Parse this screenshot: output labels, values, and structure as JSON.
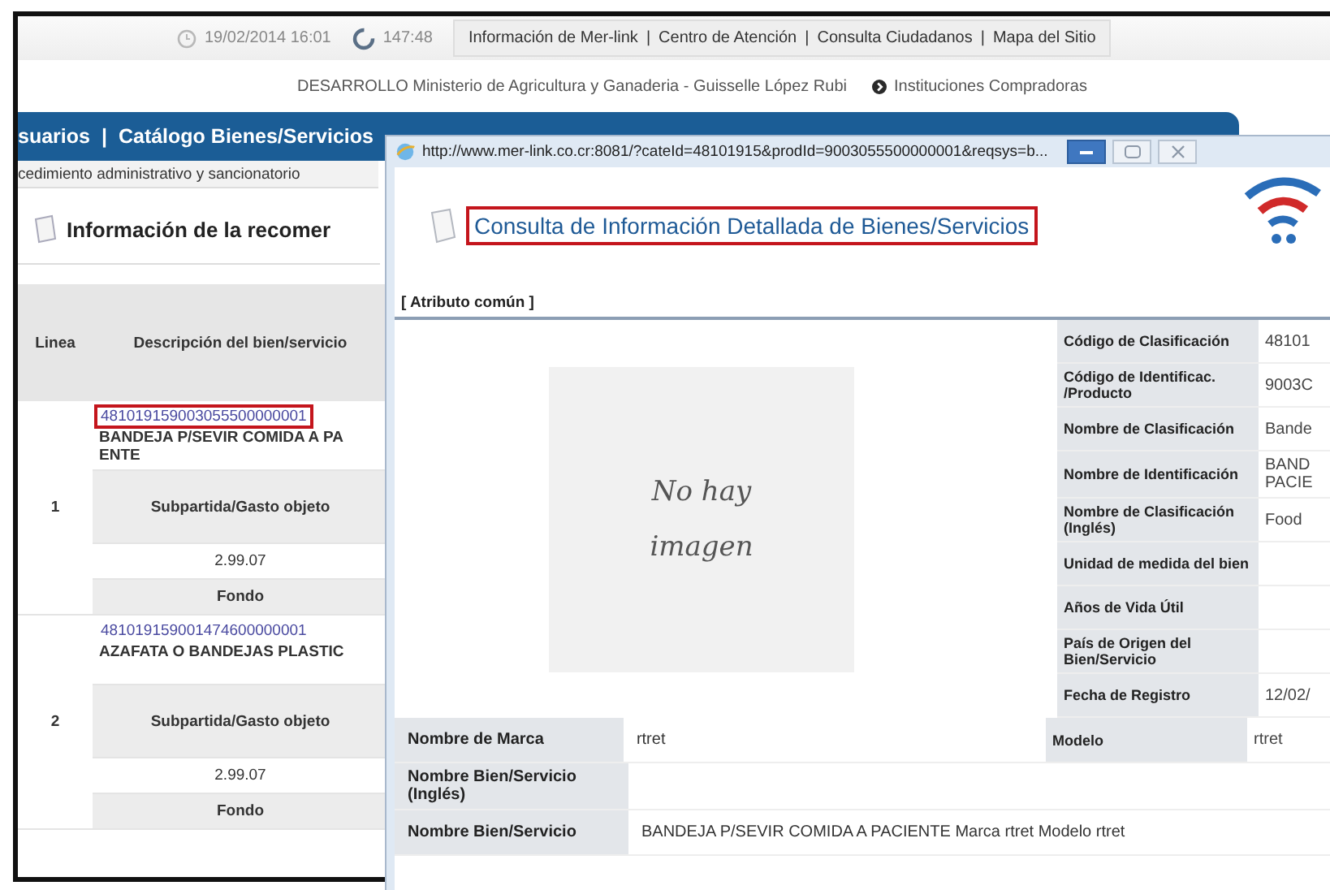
{
  "header": {
    "date": "19/02/2014 16:01",
    "timer": "147:48",
    "links": [
      "Información de Mer-link",
      "Centro de Atención",
      "Consulta Ciudadanos",
      "Mapa del Sitio"
    ],
    "separator": "|"
  },
  "user_line": {
    "text": "DESARROLLO Ministerio de Agricultura y Ganaderia - Guisselle López Rubi",
    "link": "Instituciones Compradoras"
  },
  "menu": {
    "items": [
      "suarios",
      "Catálogo Bienes/Servicios"
    ],
    "separator": "|"
  },
  "breadcrumb": "cedimiento administrativo y sancionatorio",
  "section_title": "Información de la recomer",
  "table": {
    "columns": [
      "Linea",
      "Descripción del bien/servicio"
    ],
    "rows": [
      {
        "line": "1",
        "code": "481019159003055500000001",
        "highlighted": true,
        "description": [
          "BANDEJA P/SEVIR COMIDA A PA",
          "ENTE"
        ],
        "subheading": "Subpartida/Gasto objeto",
        "subpartida": "2.99.07",
        "fund_label": "Fondo"
      },
      {
        "line": "2",
        "code": "481019159001474600000001",
        "highlighted": false,
        "description": [
          "AZAFATA O BANDEJAS PLASTIC"
        ],
        "subheading": "Subpartida/Gasto objeto",
        "subpartida": "2.99.07",
        "fund_label": "Fondo"
      }
    ]
  },
  "popup": {
    "url": "http://www.mer-link.co.cr:8081/?cateId=48101915&prodId=9003055500000001&reqsys=b...",
    "heading": "Consulta de Información Detallada de Bienes/Servicios",
    "heading_highlighted": true,
    "section": "[ Atributo común ]",
    "image_placeholder": [
      "No hay",
      "imagen"
    ],
    "attributes": [
      {
        "label": "Código de Clasificación",
        "value": "48101"
      },
      {
        "label": "Código de Identificac. /Producto",
        "value": "9003C"
      },
      {
        "label": "Nombre de Clasificación",
        "value": "Bande"
      },
      {
        "label": "Nombre de Identificación",
        "value": "BAND\nPACIE"
      },
      {
        "label": "Nombre de Clasificación (Inglés)",
        "value": "Food"
      },
      {
        "label": "Unidad de medida del bien"
      },
      {
        "label": "Años de Vida Útil"
      },
      {
        "label": "País de Origen del Bien/Servicio"
      },
      {
        "label": "Fecha de Registro",
        "value": "12/02/"
      }
    ],
    "bottom_rows": [
      {
        "label": "Nombre de Marca",
        "value": "rtret",
        "label2": "Modelo",
        "value2": "rtret"
      },
      {
        "label": "Nombre Bien/Servicio (Inglés)"
      },
      {
        "label": "Nombre Bien/Servicio",
        "value": "BANDEJA P/SEVIR COMIDA A PACIENTE Marca rtret Modelo rtret"
      }
    ]
  }
}
